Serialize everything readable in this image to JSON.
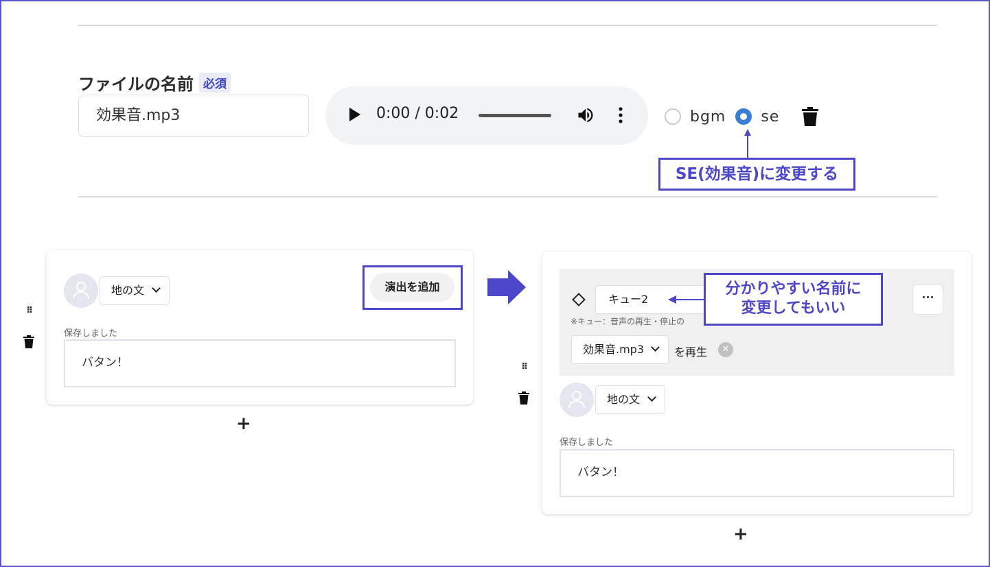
{
  "file_form": {
    "name_label": "ファイルの名前",
    "required_badge": "必須",
    "name_value": "効果音.mp3",
    "audio_time": "0:00 / 0:02",
    "radio_options": [
      "bgm",
      "se"
    ],
    "selected_option": "se"
  },
  "annotations": {
    "se_callout": "SE(効果音)に変更する",
    "name_callout_line1": "分かりやすい名前に",
    "name_callout_line2": "変更してもいい"
  },
  "before_card": {
    "speaker_select": "地の文",
    "add_effect_button": "演出を追加",
    "saved_status": "保存しました",
    "dialog_text": "バタン！",
    "add_label": "+"
  },
  "after_card": {
    "cue_name": "キュー2",
    "cue_note": "※キュー：音声の再生・停止の",
    "more_label": "···",
    "sound_select": "効果音.mp3",
    "play_suffix": "を再生",
    "remove_label": "✕",
    "speaker_select": "地の文",
    "saved_status": "保存しました",
    "dialog_text": "バタン！",
    "add_label": "+"
  },
  "colors": {
    "accent": "#4c47c9",
    "radio_checked": "#3a7fd6",
    "frame": "#5a55c9"
  }
}
